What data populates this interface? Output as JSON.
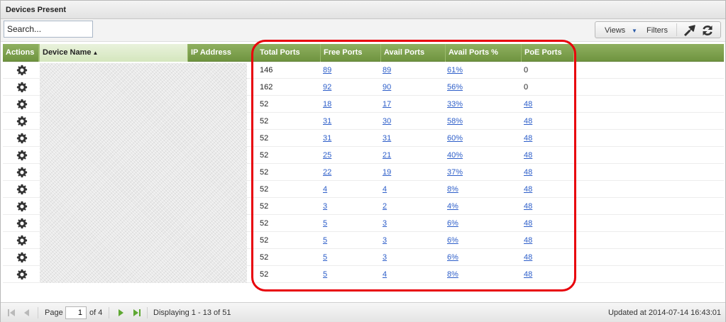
{
  "panel": {
    "title": "Devices Present"
  },
  "toolbar": {
    "search_placeholder": "Search...",
    "views_label": "Views",
    "filters_label": "Filters"
  },
  "columns": {
    "actions": "Actions",
    "device_name": "Device Name",
    "ip_address": "IP Address",
    "total_ports": "Total Ports",
    "free_ports": "Free Ports",
    "avail_ports": "Avail Ports",
    "avail_ports_pct": "Avail Ports %",
    "poe_ports": "PoE Ports"
  },
  "rows": [
    {
      "total": "146",
      "free": "89",
      "avail": "89",
      "pct": "61%",
      "poe": "0"
    },
    {
      "total": "162",
      "free": "92",
      "avail": "90",
      "pct": "56%",
      "poe": "0"
    },
    {
      "total": "52",
      "free": "18",
      "avail": "17",
      "pct": "33%",
      "poe": "48"
    },
    {
      "total": "52",
      "free": "31",
      "avail": "30",
      "pct": "58%",
      "poe": "48"
    },
    {
      "total": "52",
      "free": "31",
      "avail": "31",
      "pct": "60%",
      "poe": "48"
    },
    {
      "total": "52",
      "free": "25",
      "avail": "21",
      "pct": "40%",
      "poe": "48"
    },
    {
      "total": "52",
      "free": "22",
      "avail": "19",
      "pct": "37%",
      "poe": "48"
    },
    {
      "total": "52",
      "free": "4",
      "avail": "4",
      "pct": "8%",
      "poe": "48"
    },
    {
      "total": "52",
      "free": "3",
      "avail": "2",
      "pct": "4%",
      "poe": "48"
    },
    {
      "total": "52",
      "free": "5",
      "avail": "3",
      "pct": "6%",
      "poe": "48"
    },
    {
      "total": "52",
      "free": "5",
      "avail": "3",
      "pct": "6%",
      "poe": "48"
    },
    {
      "total": "52",
      "free": "5",
      "avail": "3",
      "pct": "6%",
      "poe": "48"
    },
    {
      "total": "52",
      "free": "5",
      "avail": "4",
      "pct": "8%",
      "poe": "48"
    }
  ],
  "pager": {
    "page_label": "Page",
    "current_page": "1",
    "of_label": "of 4",
    "displaying": "Displaying 1 - 13 of 51"
  },
  "updated": "Updated at 2014-07-14 16:43:01",
  "colors": {
    "header_green": "#7ea24e",
    "link_blue": "#2d5ec9",
    "highlight_red": "#e8000a"
  }
}
